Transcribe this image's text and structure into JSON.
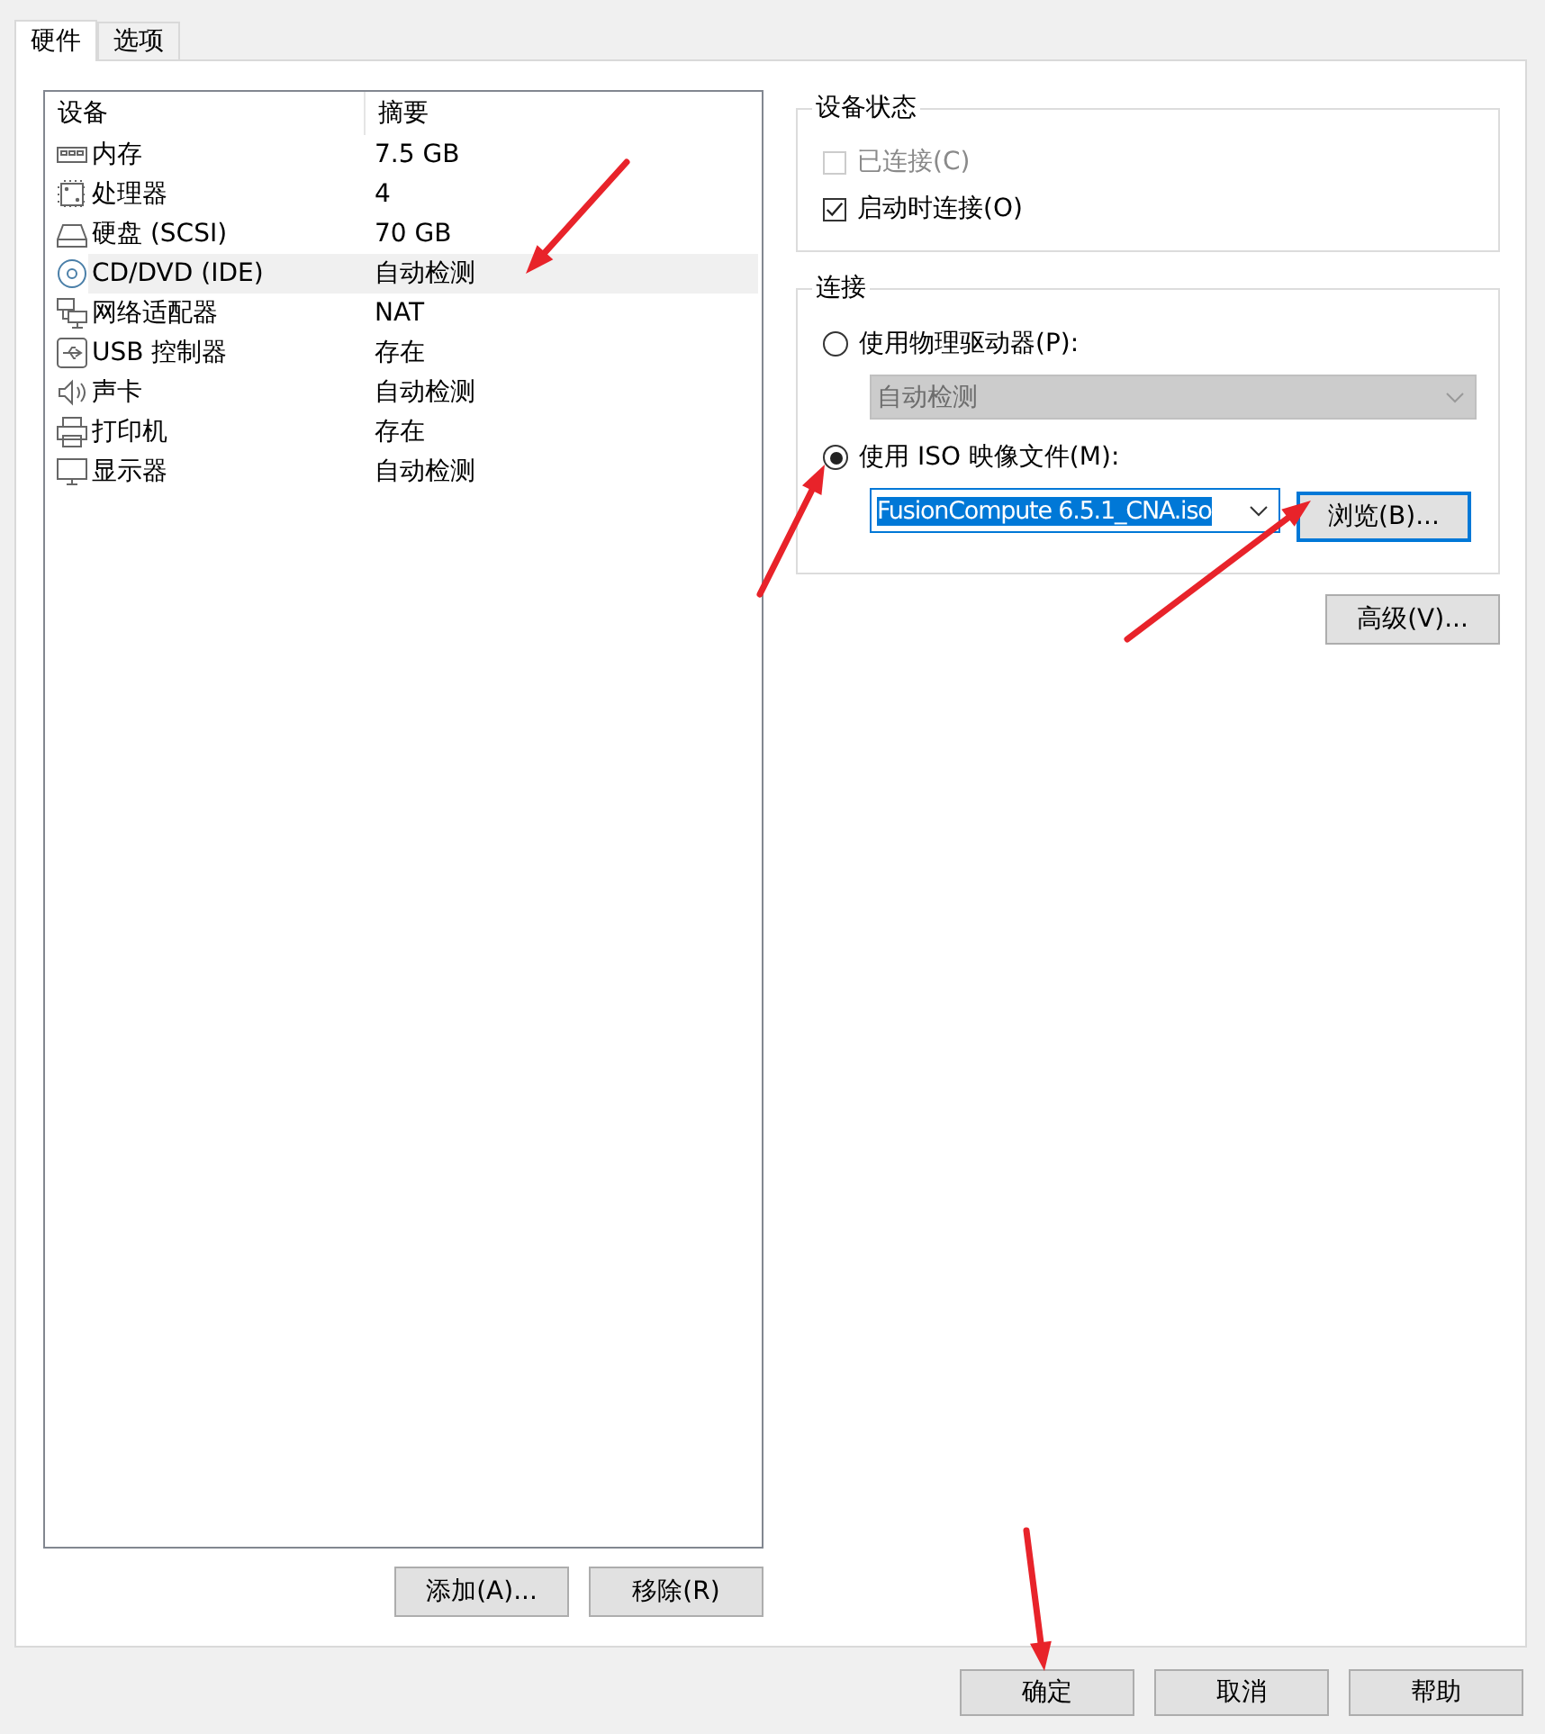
{
  "tabs": [
    {
      "label": "硬件",
      "selected": true
    },
    {
      "label": "选项",
      "selected": false
    }
  ],
  "device_list": {
    "columns": [
      "设备",
      "摘要"
    ],
    "rows": [
      {
        "kind": "memory",
        "name": "内存",
        "summary": "7.5 GB",
        "selected": false
      },
      {
        "kind": "cpu",
        "name": "处理器",
        "summary": "4",
        "selected": false
      },
      {
        "kind": "disk",
        "name": "硬盘 (SCSI)",
        "summary": "70 GB",
        "selected": false
      },
      {
        "kind": "cd",
        "name": "CD/DVD (IDE)",
        "summary": "自动检测",
        "selected": true
      },
      {
        "kind": "network",
        "name": "网络适配器",
        "summary": "NAT",
        "selected": false
      },
      {
        "kind": "usb",
        "name": "USB 控制器",
        "summary": "存在",
        "selected": false
      },
      {
        "kind": "sound",
        "name": "声卡",
        "summary": "自动检测",
        "selected": false
      },
      {
        "kind": "printer",
        "name": "打印机",
        "summary": "存在",
        "selected": false
      },
      {
        "kind": "display",
        "name": "显示器",
        "summary": "自动检测",
        "selected": false
      }
    ]
  },
  "list_buttons": [
    "添加(A)...",
    "移除(R)"
  ],
  "device_status": {
    "title": "设备状态",
    "options": [
      {
        "label": "已连接(C)",
        "checked": false,
        "disabled": true
      },
      {
        "label": "启动时连接(O)",
        "checked": true,
        "disabled": false
      }
    ]
  },
  "connection": {
    "title": "连接",
    "physical": {
      "label": "使用物理驱动器(P):",
      "selected": false,
      "drive": {
        "value": "自动检测",
        "disabled": true
      }
    },
    "iso": {
      "label": "使用 ISO 映像文件(M):",
      "selected": true,
      "file": {
        "value": "FusionCompute 6.5.1_CNA.iso",
        "disabled": false
      },
      "browse": "浏览(B)..."
    }
  },
  "advanced": "高级(V)...",
  "dialog_buttons": [
    "确定",
    "取消",
    "帮助"
  ]
}
